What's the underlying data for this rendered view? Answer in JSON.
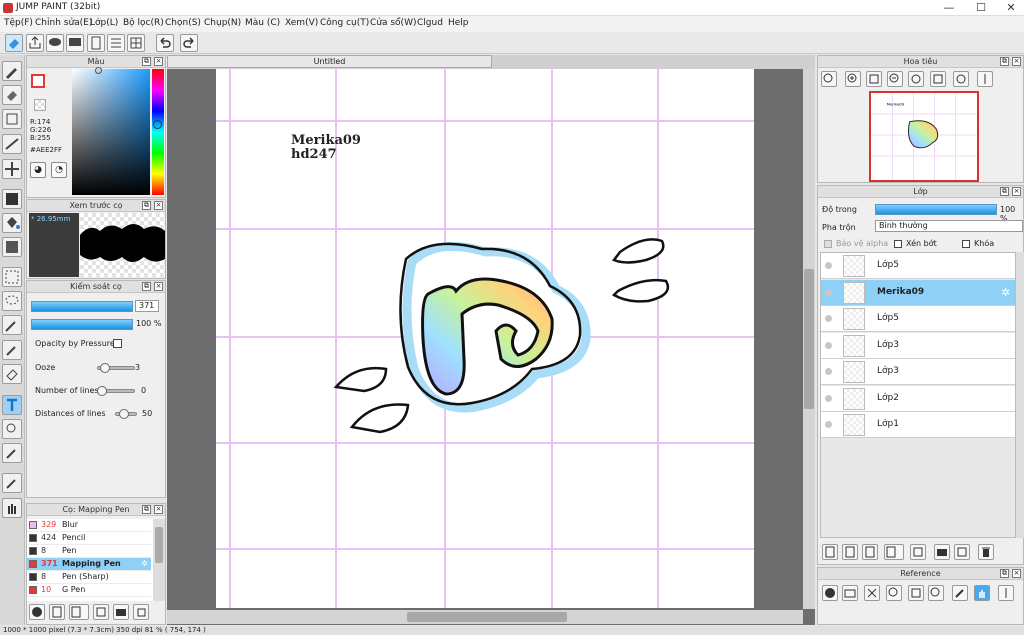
{
  "window": {
    "title": "JUMP PAINT (32bit)"
  },
  "menu": [
    "Tệp(F)",
    "Chỉnh sửa(E)",
    "Lớp(L)",
    "Bộ lọc(R)",
    "Chọn(S)",
    "Chụp(N)",
    "Màu (C)",
    "Xem(V)",
    "Công cụ(T)",
    "Cửa sổ(W)",
    "Clgud",
    "Help"
  ],
  "document": {
    "tab_title": "Untitled",
    "text_line1": "Merika09",
    "text_line2": "hd247"
  },
  "color_panel": {
    "title": "Màu",
    "r": "R:174",
    "g": "G:226",
    "b": "B:255",
    "hex": "#AEE2FF",
    "fg_color": "#aee2ff"
  },
  "brush_preview": {
    "title": "Xem trước cọ",
    "size": "* 26.95mm"
  },
  "brush_control": {
    "title": "Kiểm soát cọ",
    "size_value": "371",
    "opacity_value": "100 %",
    "opacity_pressure_label": "Opacity by Pressure",
    "ooze_label": "Ooze",
    "ooze_value": "3",
    "lines_label": "Number of lines",
    "lines_value": "0",
    "distance_label": "Distances of lines",
    "distance_value": "50"
  },
  "brushes": {
    "title": "Cọ: Mapping Pen",
    "items": [
      {
        "size": "329",
        "name": "Blur",
        "color": "#f0b8f0"
      },
      {
        "size": "424",
        "name": "Pencil",
        "color": "#333333"
      },
      {
        "size": "8",
        "name": "Pen",
        "color": "#333333"
      },
      {
        "size": "371",
        "name": "Mapping Pen",
        "color": "#e53935"
      },
      {
        "size": "8",
        "name": "Pen (Sharp)",
        "color": "#333333"
      },
      {
        "size": "10",
        "name": "G Pen",
        "color": "#e53935"
      }
    ]
  },
  "navigator": {
    "title": "Hoa tiêu"
  },
  "layers": {
    "title": "Lớp",
    "opacity_label": "Độ trong",
    "opacity_value": "100 %",
    "blend_label": "Pha trộn",
    "blend_value": "Bình thường",
    "protect_alpha": "Bảo vệ alpha",
    "clipping": "Xén bớt",
    "lock": "Khóa",
    "items": [
      {
        "name": "Lớp5"
      },
      {
        "name": "Merika09"
      },
      {
        "name": "Lớp5"
      },
      {
        "name": "Lớp3"
      },
      {
        "name": "Lớp3"
      },
      {
        "name": "Lớp2"
      },
      {
        "name": "Lớp1"
      }
    ]
  },
  "reference": {
    "title": "Reference"
  },
  "status": {
    "text": "1000 * 1000 pixel  (7.3 * 7.3cm)  350 dpi  81 %  ( 754, 174 )"
  }
}
